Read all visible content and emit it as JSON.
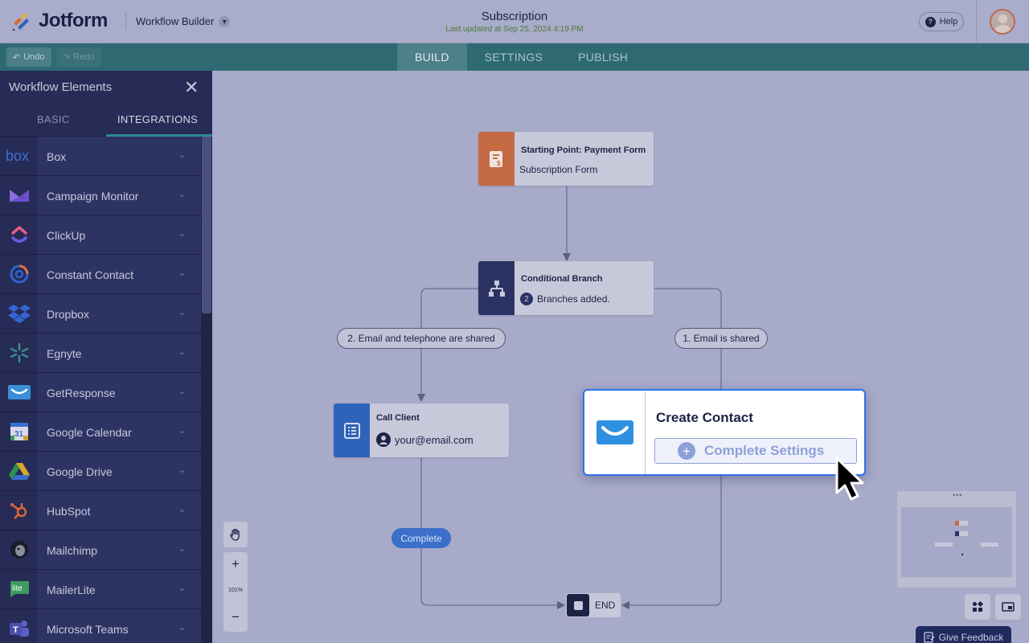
{
  "header": {
    "logo_text": "Jotform",
    "builder_label": "Workflow Builder",
    "doc_title": "Subscription",
    "doc_subtitle": "Last updated at Sep 25, 2024 4:19 PM",
    "help_label": "Help"
  },
  "toolbar": {
    "undo_label": "Undo",
    "redo_label": "Redo",
    "tabs": [
      {
        "label": "BUILD",
        "active": true
      },
      {
        "label": "SETTINGS",
        "active": false
      },
      {
        "label": "PUBLISH",
        "active": false
      }
    ]
  },
  "sidebar": {
    "title": "Workflow Elements",
    "tabs": [
      {
        "label": "BASIC",
        "active": false
      },
      {
        "label": "INTEGRATIONS",
        "active": true
      }
    ],
    "items": [
      {
        "label": "Box",
        "icon": "box-icon"
      },
      {
        "label": "Campaign Monitor",
        "icon": "campaign-monitor-icon"
      },
      {
        "label": "ClickUp",
        "icon": "clickup-icon"
      },
      {
        "label": "Constant Contact",
        "icon": "constant-contact-icon"
      },
      {
        "label": "Dropbox",
        "icon": "dropbox-icon"
      },
      {
        "label": "Egnyte",
        "icon": "egnyte-icon"
      },
      {
        "label": "GetResponse",
        "icon": "getresponse-icon"
      },
      {
        "label": "Google Calendar",
        "icon": "google-calendar-icon"
      },
      {
        "label": "Google Drive",
        "icon": "google-drive-icon"
      },
      {
        "label": "HubSpot",
        "icon": "hubspot-icon"
      },
      {
        "label": "Mailchimp",
        "icon": "mailchimp-icon"
      },
      {
        "label": "MailerLite",
        "icon": "mailerlite-icon"
      },
      {
        "label": "Microsoft Teams",
        "icon": "microsoft-teams-icon"
      }
    ]
  },
  "canvas": {
    "start_node": {
      "title": "Starting Point: Payment Form",
      "subtitle": "Subscription Form"
    },
    "branch_node": {
      "title": "Conditional Branch",
      "count": "2",
      "subtitle": "Branches added."
    },
    "branch_left_label": "2. Email and telephone are shared",
    "branch_right_label": "1. Email is shared",
    "call_node": {
      "title": "Call Client",
      "subtitle": "your@email.com"
    },
    "complete_label": "Complete",
    "create_contact": {
      "title": "Create Contact",
      "button_label": "Complete Settings"
    },
    "end_label": "END",
    "zoom_level": "101%",
    "feedback_label": "Give Feedback"
  },
  "colors": {
    "accent_blue": "#2e73e8",
    "toolbar_teal": "#2f6a73",
    "sidebar_bg": "#262c55",
    "start_node_orange": "#c46a45",
    "branch_node_navy": "#2b3264",
    "call_node_blue": "#2f63b9"
  }
}
